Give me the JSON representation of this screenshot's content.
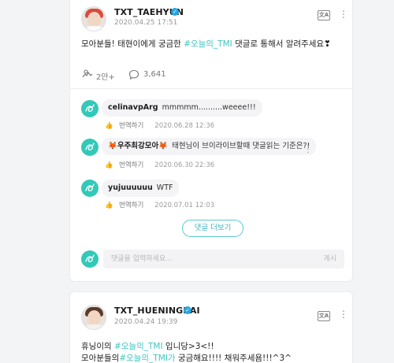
{
  "post1": {
    "author": "TXT_TAEHYUN",
    "date": "2020.04.25 17:51",
    "body_before": "모아분들! 태현이에게 궁금한 ",
    "hashtag": "#오늘의_TMI",
    "body_after": " 댓글로 통해서 알려주세요❣",
    "likes": "2만+",
    "comments": "3,641",
    "translate_icon_text": "文A",
    "comments_list": [
      {
        "author": "celinavpArg",
        "text": "mmmmm..........weeee!!!",
        "translate": "번역하기",
        "date": "2020.06.28 12:36"
      },
      {
        "author": "🦊우주최강모아🦊",
        "text": "태현님이 브이라이브할때 댓글읽는 기준은?!",
        "translate": "번역하기",
        "date": "2020.06.30 22:36"
      },
      {
        "author": "yujuuuuuu",
        "text": "WTF",
        "translate": "번역하기",
        "date": "2020.07.01 12:03"
      }
    ],
    "more_comments_label": "댓글 더보기",
    "reply_placeholder": "댓글을 입력하세요...",
    "post_button": "게시"
  },
  "post2": {
    "author": "TXT_HUENINGKAI",
    "date": "2020.04.24 19:39",
    "translate_icon_text": "文A",
    "line1_before": "휴닝이의 ",
    "line1_hashtag": "#오늘의_TMI",
    "line1_after": " 입니당>3<!!",
    "line2_before": "모아분들의",
    "line2_hashtag": "#오늘의_TMI가",
    "line2_after": " 궁금해요!!!! 채워주세욤!!!^3^"
  },
  "icons": {
    "like": "heart-hands-icon",
    "comment": "speech-bubble-icon",
    "translate": "translate-icon",
    "more": "more-vertical-icon",
    "verified": "verified-badge-icon"
  },
  "colors": {
    "accent": "#3ec6c3",
    "verified": "#23a7e0",
    "comment_avatar": "#33c9b8"
  }
}
